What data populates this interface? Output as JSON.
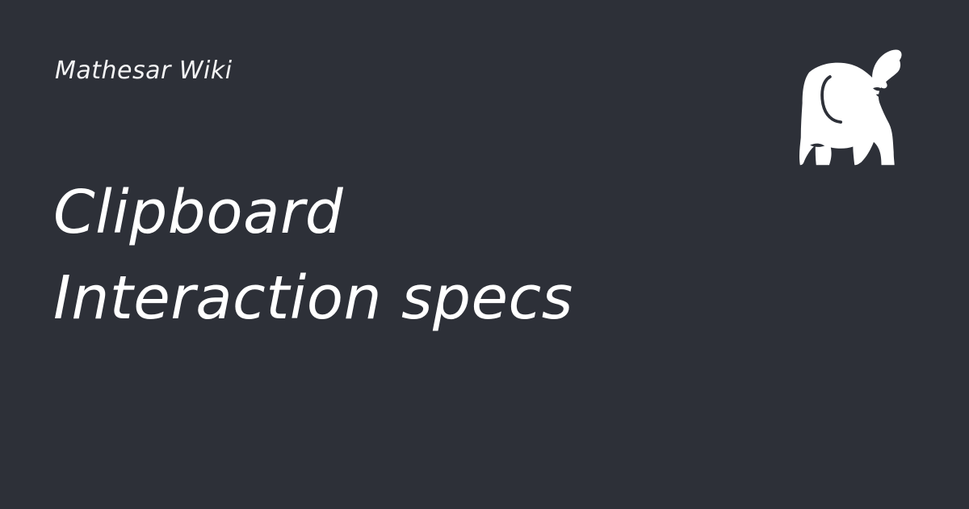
{
  "brand": {
    "site_name": "Mathesar Wiki",
    "logo_icon": "elephant-icon",
    "logo_color": "#ffffff"
  },
  "page": {
    "title_line_1": "Clipboard",
    "title_line_2": "Interaction specs"
  },
  "colors": {
    "background": "#2d3038",
    "text": "#ffffff"
  }
}
